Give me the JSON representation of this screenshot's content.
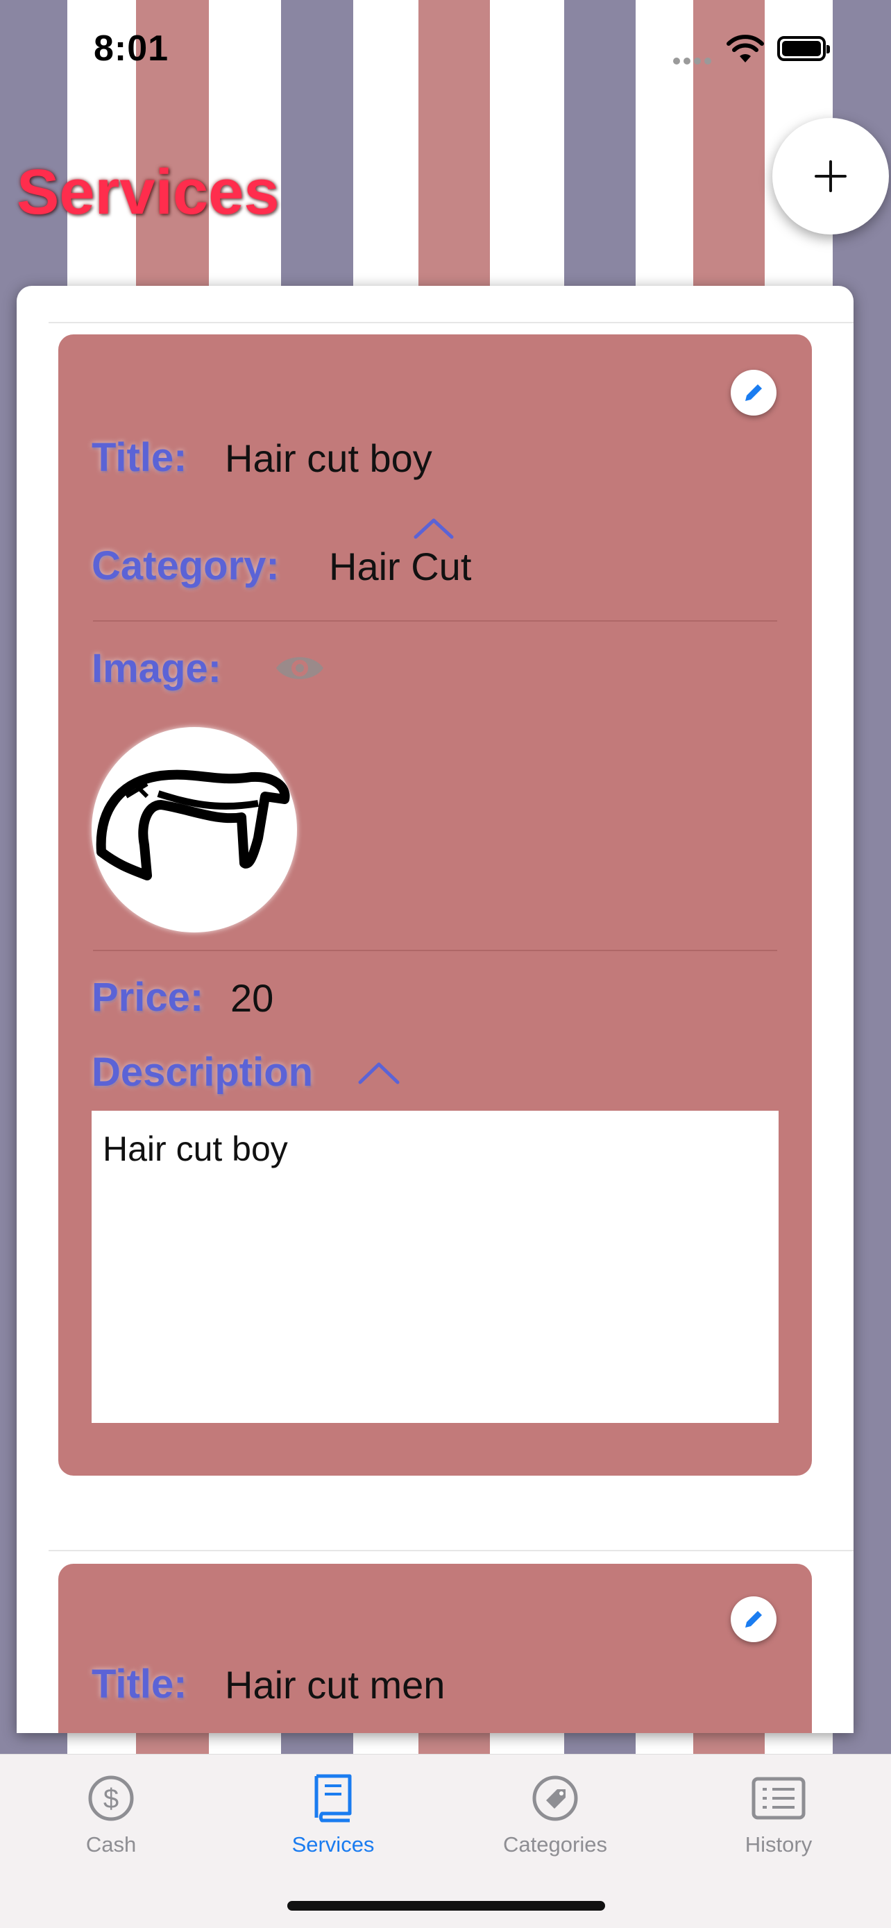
{
  "status_bar": {
    "time": "8:01"
  },
  "header": {
    "title": "Services",
    "add_icon": "plus-icon"
  },
  "services": [
    {
      "title_label": "Title:",
      "title": "Hair cut boy",
      "category_label": "Category:",
      "category": "Hair Cut",
      "image_label": "Image:",
      "price_label": "Price:",
      "price": "20",
      "description_label": "Description",
      "description": "Hair cut boy"
    },
    {
      "title_label": "Title:",
      "title": "Hair cut men"
    }
  ],
  "tabbar": {
    "items": [
      {
        "label": "Cash",
        "icon": "dollar-circle-icon",
        "active": false
      },
      {
        "label": "Services",
        "icon": "book-icon",
        "active": true
      },
      {
        "label": "Categories",
        "icon": "tag-icon",
        "active": false
      },
      {
        "label": "History",
        "icon": "list-icon",
        "active": false
      }
    ]
  },
  "colors": {
    "accent": "#1a7cf0",
    "title": "#ff2d4d",
    "card": "#c27a7a",
    "label": "#5b63d6"
  }
}
